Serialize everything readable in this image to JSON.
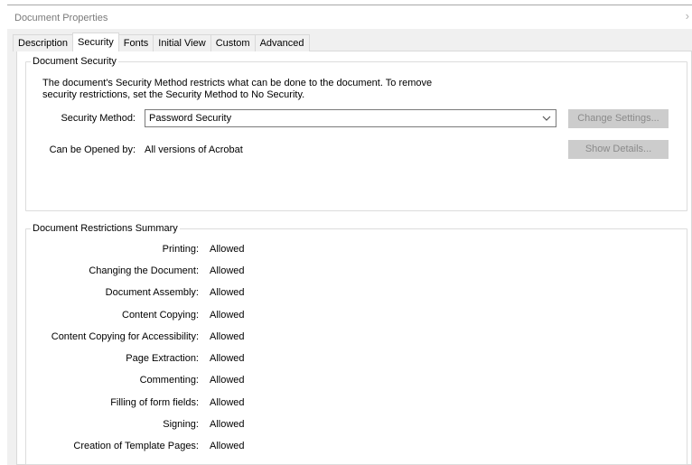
{
  "window": {
    "title": "Document Properties",
    "close_glyph": "›"
  },
  "tabs": [
    {
      "label": "Description"
    },
    {
      "label": "Security"
    },
    {
      "label": "Fonts"
    },
    {
      "label": "Initial View"
    },
    {
      "label": "Custom"
    },
    {
      "label": "Advanced"
    }
  ],
  "active_tab": "Security",
  "security": {
    "legend": "Document Security",
    "description_line1": "The document's Security Method restricts what can be done to the document. To remove",
    "description_line2": "security restrictions, set the Security Method to No Security.",
    "method_label": "Security Method:",
    "method_value": "Password Security",
    "opened_label": "Can be Opened by:",
    "opened_value": "All versions of Acrobat",
    "change_settings_label": "Change Settings...",
    "show_details_label": "Show Details..."
  },
  "restrictions": {
    "legend": "Document Restrictions Summary",
    "rows": [
      {
        "label": "Printing:",
        "value": "Allowed"
      },
      {
        "label": "Changing the Document:",
        "value": "Allowed"
      },
      {
        "label": "Document Assembly:",
        "value": "Allowed"
      },
      {
        "label": "Content Copying:",
        "value": "Allowed"
      },
      {
        "label": "Content Copying for Accessibility:",
        "value": "Allowed"
      },
      {
        "label": "Page Extraction:",
        "value": "Allowed"
      },
      {
        "label": "Commenting:",
        "value": "Allowed"
      },
      {
        "label": "Filling of form fields:",
        "value": "Allowed"
      },
      {
        "label": "Signing:",
        "value": "Allowed"
      },
      {
        "label": "Creation of Template Pages:",
        "value": "Allowed"
      }
    ]
  },
  "icons": {
    "dropdown": "chevron-down-icon",
    "close": "close-icon"
  },
  "colors": {
    "disabled_button_bg": "#cccccc",
    "disabled_button_text": "#8a8a8a",
    "panel_bg": "#f0f0f0"
  }
}
